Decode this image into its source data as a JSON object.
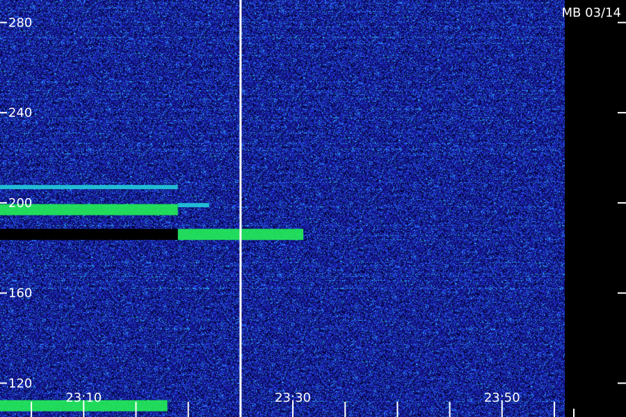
{
  "header": {
    "title": "MB 03/14"
  },
  "chart_data": {
    "type": "heatmap",
    "title": "MB 03/14",
    "xlabel": "",
    "ylabel": "",
    "y_ticks": [
      "120",
      "160",
      "200",
      "240",
      "280"
    ],
    "y_range": [
      105,
      290
    ],
    "x_ticks": [
      "23:10",
      "23:30",
      "23:50"
    ],
    "x_range": [
      "23:02",
      "23:56"
    ],
    "marker_time": "23:25",
    "grid": false,
    "colormap": [
      "#000000",
      "#0a0a6e",
      "#1a1ac8",
      "#2a6cff",
      "#33ccff",
      "#22ff66",
      "#aaff22",
      "#ffff00"
    ],
    "bands": [
      {
        "freq": 207,
        "t_start": "23:02",
        "t_end": "23:19",
        "intensity": "medium"
      },
      {
        "freq": 197,
        "t_start": "23:02",
        "t_end": "23:19",
        "intensity": "high"
      },
      {
        "freq": 199,
        "t_start": "23:19",
        "t_end": "23:22",
        "intensity": "medium"
      },
      {
        "freq": 186,
        "t_start": "23:19",
        "t_end": "23:31",
        "intensity": "high"
      },
      {
        "freq": 186,
        "t_start": "23:02",
        "t_end": "23:19",
        "intensity": "none"
      },
      {
        "freq": 110,
        "t_start": "23:02",
        "t_end": "23:18",
        "intensity": "high"
      }
    ]
  }
}
